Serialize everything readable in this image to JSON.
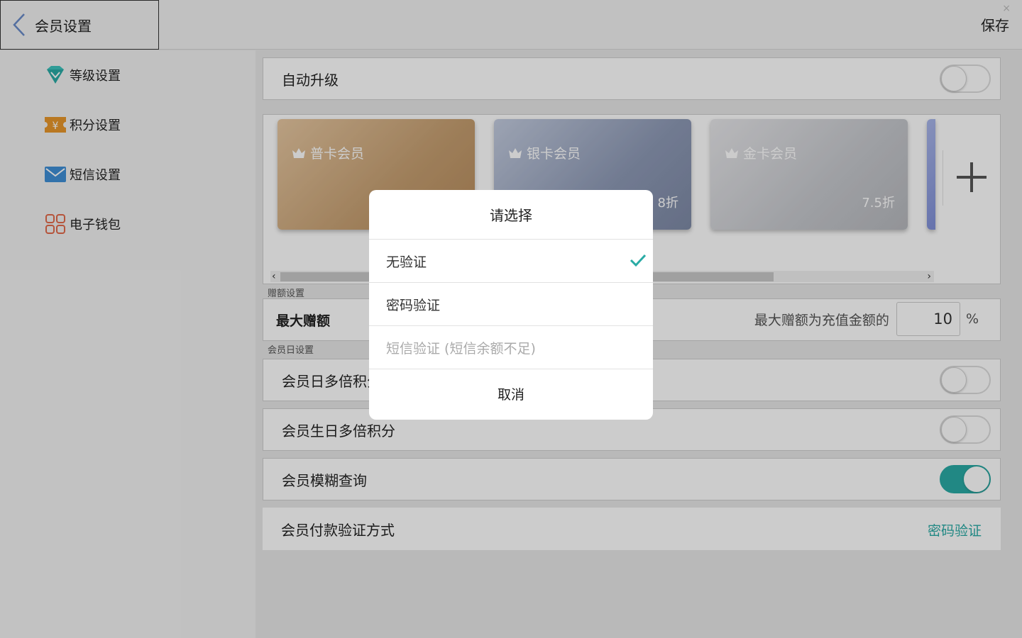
{
  "header": {
    "title": "会员设置",
    "save_label": "保存",
    "close_glyph": "×"
  },
  "sidebar": {
    "items": [
      {
        "label": "等级设置",
        "icon": "diamond-icon"
      },
      {
        "label": "积分设置",
        "icon": "ticket-yen-icon"
      },
      {
        "label": "短信设置",
        "icon": "mail-icon"
      },
      {
        "label": "电子钱包",
        "icon": "grid-apps-icon"
      }
    ]
  },
  "main": {
    "auto_upgrade": {
      "label": "自动升级",
      "enabled": false
    },
    "cards": [
      {
        "name": "普卡会员",
        "discount": ""
      },
      {
        "name": "银卡会员",
        "discount": "8折"
      },
      {
        "name": "金卡会员",
        "discount": "7.5折"
      }
    ],
    "scroll_left": "‹",
    "scroll_right": "›",
    "bonus_section": {
      "title": "赠额设置",
      "label": "最大赠额",
      "text": "最大赠额为充值金额的",
      "value": "10",
      "unit": "%"
    },
    "member_day_section": {
      "title": "会员日设置",
      "rows": [
        {
          "label": "会员日多倍积分",
          "enabled": false
        },
        {
          "label": "会员生日多倍积分",
          "enabled": false
        },
        {
          "label": "会员模糊查询",
          "enabled": true
        }
      ]
    },
    "payment_verify": {
      "label": "会员付款验证方式",
      "value": "密码验证"
    }
  },
  "dialog": {
    "title": "请选择",
    "options": [
      {
        "label": "无验证",
        "selected": true,
        "disabled": false
      },
      {
        "label": "密码验证",
        "selected": false,
        "disabled": false
      },
      {
        "label": "短信验证 (短信余额不足)",
        "selected": false,
        "disabled": true
      }
    ],
    "cancel_label": "取消"
  },
  "colors": {
    "accent": "#2aaba5",
    "overlay": "rgba(0,0,0,0.2)"
  }
}
